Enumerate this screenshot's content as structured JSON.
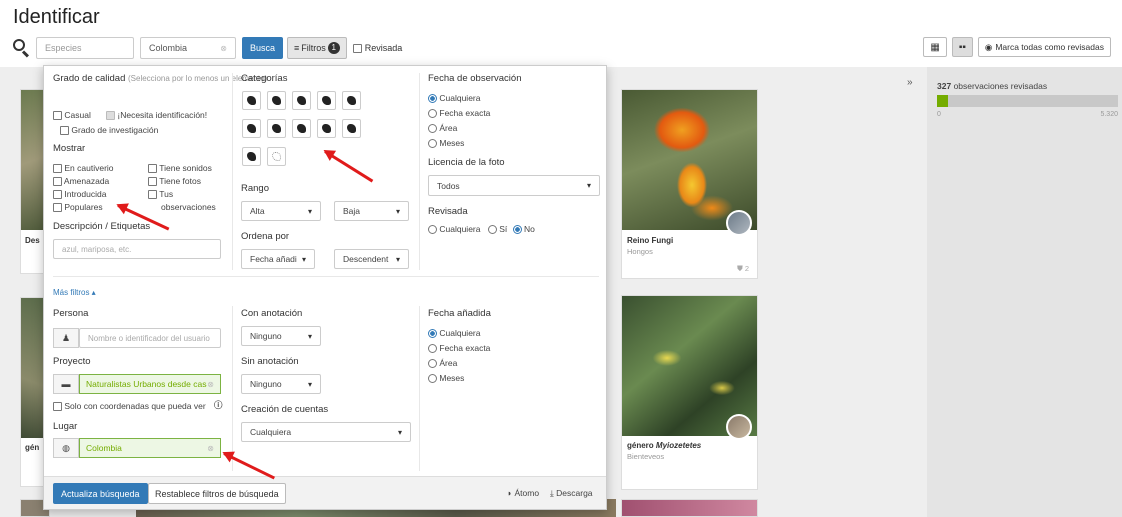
{
  "page": {
    "title": "Identificar"
  },
  "toolbar": {
    "species_placeholder": "Especies",
    "place_value": "Colombia",
    "search_label": "Busca",
    "filters_label": "Filtros",
    "filters_count": "1",
    "reviewed_label": "Revisada"
  },
  "right_tools": {
    "mark_all_label": "Marca todas como revisadas"
  },
  "stats": {
    "reviewed_count": "327",
    "reviewed_label": "observaciones revisadas",
    "progress_min": "0",
    "progress_max": "5.320",
    "progress_fraction": 0.061
  },
  "cards": [
    {
      "title": "Reino Fungi",
      "subtitle": "Hongos",
      "ids_count": "2"
    },
    {
      "title_prefix": "género",
      "title_name": "Myiozetetes",
      "subtitle": "Bienteveos"
    }
  ],
  "card_partials": {
    "left_top": "Des",
    "left_bottom": "gén"
  },
  "filters": {
    "quality": {
      "heading": "Grado de calidad",
      "hint": "(Selecciona por lo menos un elemento)",
      "casual": "Casual",
      "needs_id": "¡Necesita identificación!",
      "research": "Grado de investigación"
    },
    "show": {
      "heading": "Mostrar",
      "captive": "En cautiverio",
      "threatened": "Amenazada",
      "introduced": "Introducida",
      "popular": "Populares",
      "has_sounds": "Tiene sonidos",
      "has_photos": "Tiene fotos",
      "your_obs_1": "Tus",
      "your_obs_2": "observaciones"
    },
    "desc": {
      "heading": "Descripción / Etiquetas",
      "placeholder": "azul, mariposa, etc."
    },
    "categories": {
      "heading": "Categorías"
    },
    "rank": {
      "heading": "Rango",
      "high": "Alta",
      "low": "Baja"
    },
    "order": {
      "heading": "Ordena por",
      "by": "Fecha añadi",
      "dir": "Descendent"
    },
    "obs_date": {
      "heading": "Fecha de observación",
      "any": "Cualquiera",
      "exact": "Fecha exacta",
      "range": "Área",
      "months": "Meses"
    },
    "license": {
      "heading": "Licencia de la foto",
      "value": "Todos"
    },
    "reviewed": {
      "heading": "Revisada",
      "any": "Cualquiera",
      "yes": "Sí",
      "no": "No"
    },
    "more_filters": "Más filtros ▴",
    "person": {
      "heading": "Persona",
      "placeholder": "Nombre o identificador del usuario"
    },
    "project": {
      "heading": "Proyecto",
      "value": "Naturalistas Urbanos desde casa"
    },
    "coords_label": "Solo con coordenadas que pueda ver",
    "place": {
      "heading": "Lugar",
      "value": "Colombia"
    },
    "with_annotation": {
      "heading": "Con anotación",
      "value": "Ninguno"
    },
    "without_annotation": {
      "heading": "Sin anotación",
      "value": "Ninguno"
    },
    "account_creation": {
      "heading": "Creación de cuentas",
      "value": "Cualquiera"
    },
    "date_added": {
      "heading": "Fecha añadida",
      "any": "Cualquiera",
      "exact": "Fecha exacta",
      "range": "Área",
      "months": "Meses"
    },
    "update_button": "Actualiza búsqueda",
    "reset_button": "Restablece filtros de búsqueda",
    "atom_link": "Átomo",
    "download_link": "Descarga"
  },
  "colors": {
    "accent": "#337ab7",
    "green": "#74ac00",
    "annotation_red": "#e01b1b"
  }
}
